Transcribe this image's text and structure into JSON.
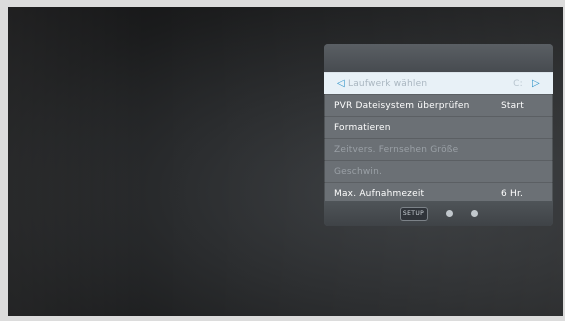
{
  "osd": {
    "rows": [
      {
        "label": "Laufwerk wählen",
        "value": "C:",
        "state": "selected"
      },
      {
        "label": "PVR Dateisystem überprüfen",
        "value": "Start",
        "state": "normal"
      },
      {
        "label": "Formatieren",
        "value": "",
        "state": "normal"
      },
      {
        "label": "Zeitvers. Fernsehen Größe",
        "value": "",
        "state": "disabled"
      },
      {
        "label": "Geschwin.",
        "value": "",
        "state": "disabled"
      },
      {
        "label": "Max. Aufnahmezeit",
        "value": "6 Hr.",
        "state": "normal"
      }
    ],
    "bottom": {
      "setup_label": "SETUP"
    }
  }
}
